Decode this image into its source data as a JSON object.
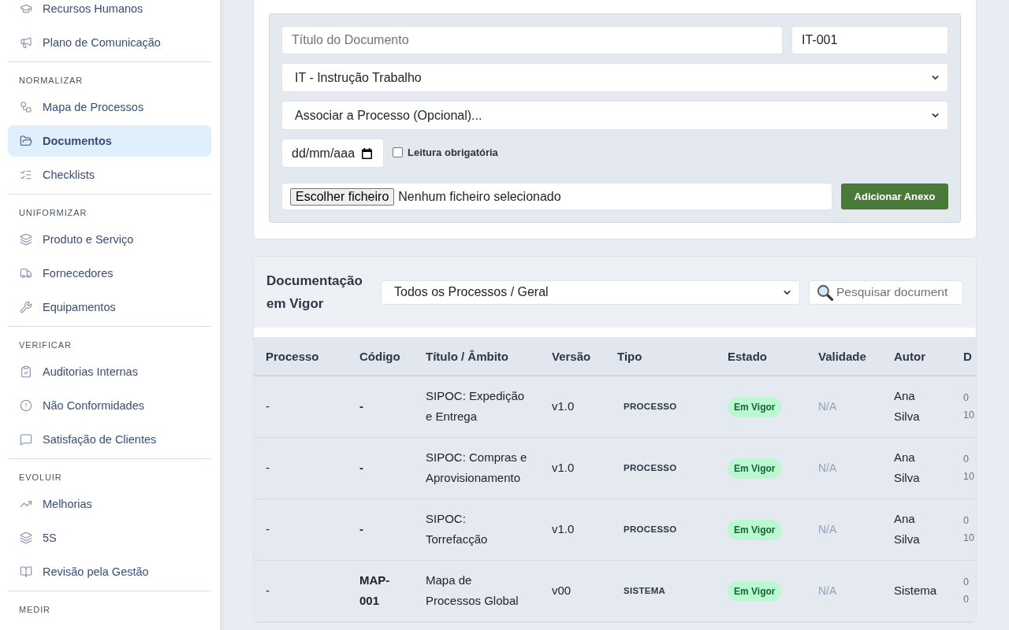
{
  "sidebar": {
    "groups": [
      {
        "items": [
          {
            "label": "Recursos Humanos",
            "selected": false
          },
          {
            "label": "Plano de Comunicação",
            "selected": false
          }
        ]
      },
      {
        "label": "NORMALIZAR",
        "items": [
          {
            "label": "Mapa de Processos",
            "selected": false
          },
          {
            "label": "Documentos",
            "selected": true
          },
          {
            "label": "Checklists",
            "selected": false
          }
        ]
      },
      {
        "label": "UNIFORMIZAR",
        "items": [
          {
            "label": "Produto e Serviço",
            "selected": false
          },
          {
            "label": "Fornecedores",
            "selected": false
          },
          {
            "label": "Equipamentos",
            "selected": false
          }
        ]
      },
      {
        "label": "VERIFICAR",
        "items": [
          {
            "label": "Auditorias Internas",
            "selected": false
          },
          {
            "label": "Não Conformidades",
            "selected": false
          },
          {
            "label": "Satisfação de Clientes",
            "selected": false
          }
        ]
      },
      {
        "label": "EVOLUIR",
        "items": [
          {
            "label": "Melhorias",
            "selected": false
          },
          {
            "label": "5S",
            "selected": false
          },
          {
            "label": "Revisão pela Gestão",
            "selected": false
          }
        ]
      },
      {
        "label": "MEDIR"
      }
    ]
  },
  "document_form": {
    "title_field": {
      "placeholder": "Título do Documento"
    },
    "code_field": {
      "value": "IT-001"
    },
    "type_select": {
      "value": "IT - Instrução Trabalho"
    },
    "process_select": {
      "value": "Associar a Processo (Opcional)..."
    },
    "date_field": {
      "placeholder": "dd/mm/aaa"
    },
    "mandatory_reading": {
      "label": "Leitura obrigatória",
      "checked": false
    },
    "file_picker": {
      "button": "Escolher ficheiro",
      "status": "Nenhum ficheiro selecionado"
    },
    "submit_button": "Adicionar Anexo"
  },
  "documents_panel": {
    "title": "Documentação em Vigor",
    "process_filter": {
      "value": "Todos os Processos / Geral"
    },
    "search": {
      "placeholder": "Pesquisar document"
    },
    "table": {
      "columns": [
        "Processo",
        "Código",
        "Título / Âmbito",
        "Versão",
        "Tipo",
        "Estado",
        "Validade",
        "Autor",
        "D"
      ],
      "rows": [
        {
          "process": "-",
          "code": "-",
          "title": "SIPOC: Expedição e Entrega",
          "version": "v1.0",
          "type": "PROCESSO",
          "status": "Em Vigor",
          "validity": "N/A",
          "author": "Ana Silva",
          "column_9": [
            "0",
            "10"
          ]
        },
        {
          "process": "-",
          "code": "-",
          "title": "SIPOC: Compras e Aprovisionamento",
          "version": "v1.0",
          "type": "PROCESSO",
          "status": "Em Vigor",
          "validity": "N/A",
          "author": "Ana Silva",
          "column_9": [
            "0",
            "10"
          ]
        },
        {
          "process": "-",
          "code": "-",
          "title": "SIPOC: Torrefacção",
          "version": "v1.0",
          "type": "PROCESSO",
          "status": "Em Vigor",
          "validity": "N/A",
          "author": "Ana Silva",
          "column_9": [
            "0",
            "10"
          ]
        },
        {
          "process": "-",
          "code": "MAP-001",
          "title": "Mapa de Processos Global",
          "version": "v00",
          "type": "SISTEMA",
          "status": "Em Vigor",
          "validity": "N/A",
          "author": "Sistema",
          "column_9": [
            "0",
            "0"
          ]
        }
      ]
    }
  }
}
